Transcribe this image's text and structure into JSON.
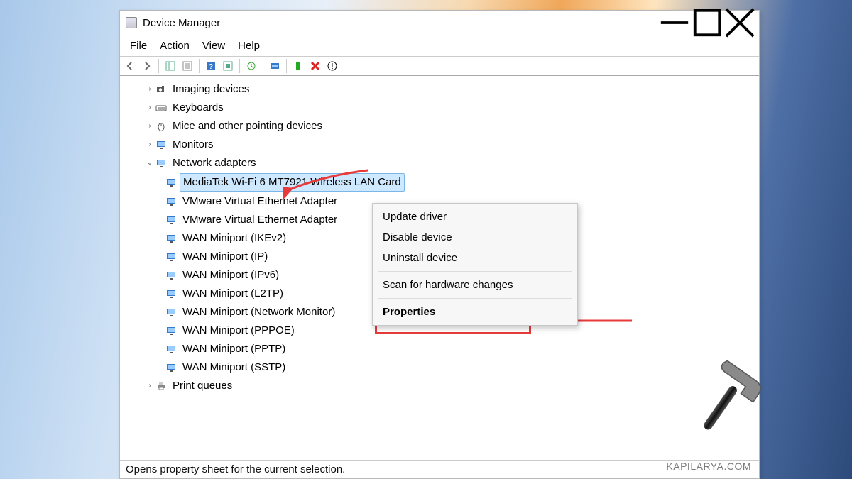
{
  "window": {
    "title": "Device Manager"
  },
  "menu": {
    "file": "File",
    "action": "Action",
    "view": "View",
    "help": "Help"
  },
  "tree": {
    "imaging": "Imaging devices",
    "keyboards": "Keyboards",
    "mice": "Mice and other pointing devices",
    "monitors": "Monitors",
    "network": "Network adapters",
    "adapters": [
      "MediaTek Wi-Fi 6 MT7921 Wireless LAN Card",
      "VMware Virtual Ethernet Adapter",
      "VMware Virtual Ethernet Adapter",
      "WAN Miniport (IKEv2)",
      "WAN Miniport (IP)",
      "WAN Miniport (IPv6)",
      "WAN Miniport (L2TP)",
      "WAN Miniport (Network Monitor)",
      "WAN Miniport (PPPOE)",
      "WAN Miniport (PPTP)",
      "WAN Miniport (SSTP)"
    ],
    "print": "Print queues"
  },
  "context_menu": {
    "update": "Update driver",
    "disable": "Disable device",
    "uninstall": "Uninstall device",
    "scan": "Scan for hardware changes",
    "properties": "Properties"
  },
  "status": "Opens property sheet for the current selection.",
  "watermark": "KAPILARYA.COM"
}
